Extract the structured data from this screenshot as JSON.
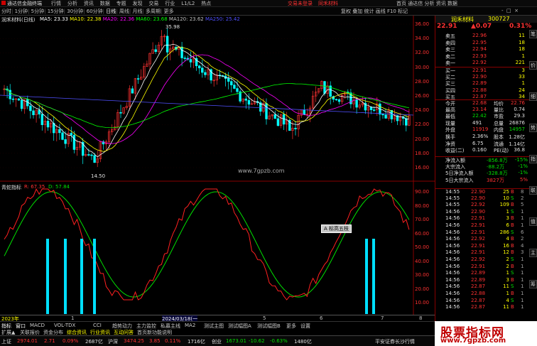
{
  "app": {
    "title": "通达信金融终端",
    "menu": [
      "行情",
      "分析",
      "资讯",
      "数据",
      "专题",
      "发现",
      "交易",
      "行业",
      "L1/L2",
      "热点"
    ],
    "ad1": "交易未登录",
    "ad2": "同禾材料",
    "right_menu": [
      "首页",
      "通达信",
      "分析",
      "资讯",
      "数据"
    ]
  },
  "toolbar": {
    "periods": [
      "分时",
      "1分钟",
      "5分钟",
      "15分钟",
      "30分钟",
      "60分钟",
      "日线",
      "周线",
      "月线",
      "多周期",
      "更多"
    ],
    "right": [
      "复权",
      "叠加",
      "统计",
      "画线",
      "F10",
      "标记",
      "-",
      "□",
      "×"
    ]
  },
  "stock": {
    "name": "润禾材料",
    "code": "300727",
    "price": "22.91",
    "change": "0.07",
    "pct": "0.31%",
    "chart_title": "润禾材料(日线)",
    "ma": [
      {
        "label": "MA5: 23.33",
        "color": "#ffffff"
      },
      {
        "label": "MA10: 22.38",
        "color": "#ffff00"
      },
      {
        "label": "MA20: 22.36",
        "color": "#ff00ff"
      },
      {
        "label": "MA60: 23.68",
        "color": "#00ff00"
      },
      {
        "label": "MA120: 23.62",
        "color": "#c0c0c0"
      },
      {
        "label": "MA250: 25.42",
        "color": "#5050ff"
      }
    ],
    "high_label": "35.98",
    "low_label": "14.50",
    "watermark": "www.7gpzb.com"
  },
  "price_axis": [
    "36.00",
    "34.00",
    "32.00",
    "30.00",
    "28.00",
    "26.00",
    "24.00",
    "22.00",
    "20.00",
    "18.00",
    "16.00"
  ],
  "indicator": {
    "name": "青蛇指标",
    "red_label": "R: 67.35",
    "green_label": "D: 57.84",
    "axis": [
      "90.00",
      "80.00",
      "70.00",
      "60.00",
      "50.00",
      "40.00",
      "30.00",
      "20.00",
      "10.00"
    ],
    "popup": "A 标高五枝"
  },
  "timeline": {
    "labels": [
      "2023年",
      "1",
      "2024/03/18(一",
      "5",
      "6",
      "7",
      "8"
    ]
  },
  "bottom_tabs": [
    "指标",
    "窗口",
    "MACD",
    "VOL-TDX",
    "CCI",
    "趋势动力",
    "主力监控",
    "私募主线",
    "MA2",
    "测试主图",
    "测试幅图A",
    "测试幅图B",
    "更多",
    "设置"
  ],
  "bottom_tabs2": [
    "扩展▲",
    "关联报价",
    "资金分布",
    "综合资讯",
    "行业资讯",
    "互动问答",
    "首页新功能说明"
  ],
  "orderbook": [
    {
      "label": "卖五",
      "price": "22.96",
      "vol": "11"
    },
    {
      "label": "卖四",
      "price": "22.95",
      "vol": "18"
    },
    {
      "label": "卖三",
      "price": "22.94",
      "vol": "18"
    },
    {
      "label": "卖二",
      "price": "22.93",
      "vol": "1"
    },
    {
      "label": "卖一",
      "price": "22.92",
      "vol": "221"
    },
    {
      "label": "买一",
      "price": "22.91",
      "vol": "3"
    },
    {
      "label": "买二",
      "price": "22.90",
      "vol": "33"
    },
    {
      "label": "买三",
      "price": "22.89",
      "vol": "1"
    },
    {
      "label": "买四",
      "price": "22.88",
      "vol": "24"
    },
    {
      "label": "买五",
      "price": "22.87",
      "vol": "34"
    }
  ],
  "stats": [
    {
      "l1": "今开",
      "v1": "22.68",
      "c1": "red",
      "l2": "均价",
      "v2": "22.76",
      "c2": "red"
    },
    {
      "l1": "最高",
      "v1": "23.14",
      "c1": "red",
      "l2": "量比",
      "v2": "0.74",
      "c2": "wht"
    },
    {
      "l1": "最低",
      "v1": "22.42",
      "c1": "grn",
      "l2": "市盈",
      "v2": "29.3",
      "c2": "wht"
    },
    {
      "l1": "现量",
      "v1": "491",
      "c1": "wht",
      "l2": "总量",
      "v2": "26876",
      "c2": "wht"
    },
    {
      "l1": "外盘",
      "v1": "11919",
      "c1": "red",
      "l2": "内盘",
      "v2": "14957",
      "c2": "grn"
    },
    {
      "l1": "换手",
      "v1": "2.36%",
      "c1": "wht",
      "l2": "股本",
      "v2": "1.28亿",
      "c2": "wht"
    },
    {
      "l1": "净资",
      "v1": "6.75",
      "c1": "wht",
      "l2": "流通",
      "v2": "1.14亿",
      "c2": "wht"
    },
    {
      "l1": "收益(二)",
      "v1": "0.160",
      "c1": "wht",
      "l2": "PE(动)",
      "v2": "36.8",
      "c2": "wht"
    }
  ],
  "flows": [
    {
      "label": "净流入额",
      "val": "-856.8万",
      "pct": "-15%"
    },
    {
      "label": "大宗流入",
      "val": "-88.2万",
      "pct": "-1%"
    },
    {
      "label": "5日净流入额",
      "val": "-328.8万",
      "pct": "-1%"
    },
    {
      "label": "5日大宗流入",
      "val": "3827万",
      "pct": "5%"
    }
  ],
  "ticks": [
    {
      "t": "14:55",
      "p": "22.90",
      "v": "25",
      "d": "B",
      "n": "8"
    },
    {
      "t": "14:55",
      "p": "22.90",
      "v": "10",
      "d": "S",
      "n": "2"
    },
    {
      "t": "14:55",
      "p": "22.92",
      "v": "109",
      "d": "B",
      "n": "5"
    },
    {
      "t": "14:56",
      "p": "22.90",
      "v": "1",
      "d": "S",
      "n": "1"
    },
    {
      "t": "14:56",
      "p": "22.91",
      "v": "3",
      "d": "B",
      "n": "1"
    },
    {
      "t": "14:56",
      "p": "22.91",
      "v": "6",
      "d": "B",
      "n": "1"
    },
    {
      "t": "14:56",
      "p": "22.91",
      "v": "286",
      "d": "S",
      "n": "6"
    },
    {
      "t": "14:56",
      "p": "22.92",
      "v": "4",
      "d": "B",
      "n": "2"
    },
    {
      "t": "14:56",
      "p": "22.91",
      "v": "16",
      "d": "B",
      "n": "4"
    },
    {
      "t": "14:56",
      "p": "22.91",
      "v": "12",
      "d": "B",
      "n": "3"
    },
    {
      "t": "14:56",
      "p": "22.92",
      "v": "2",
      "d": "S",
      "n": "1"
    },
    {
      "t": "14:56",
      "p": "22.91",
      "v": "2",
      "d": "B",
      "n": "1"
    },
    {
      "t": "14:56",
      "p": "22.89",
      "v": "1",
      "d": "S",
      "n": "1"
    },
    {
      "t": "14:56",
      "p": "22.89",
      "v": "3",
      "d": "B",
      "n": "1"
    },
    {
      "t": "14:56",
      "p": "22.87",
      "v": "11",
      "d": "S",
      "n": "1"
    },
    {
      "t": "14:56",
      "p": "22.88",
      "v": "1",
      "d": "B",
      "n": "1"
    },
    {
      "t": "14:56",
      "p": "22.87",
      "v": "4",
      "d": "S",
      "n": "1"
    },
    {
      "t": "14:56",
      "p": "22.87",
      "v": "11",
      "d": "B",
      "n": "1"
    }
  ],
  "right_tabs": [
    "笔",
    "价",
    "细",
    "势",
    "指",
    "联",
    "值",
    "主",
    "筹"
  ],
  "status": {
    "items": [
      {
        "name": "上证",
        "price": "2974.01",
        "chg": "2.71",
        "pct": "0.09%",
        "vol": "2687亿"
      },
      {
        "name": "沪深",
        "price": "3474.25",
        "chg": "3.85",
        "pct": "0.11%",
        "vol": "1716亿"
      },
      {
        "name": "创业",
        "price": "1673.01",
        "chg": "-10.62",
        "pct": "-0.63%",
        "vol": "1480亿"
      }
    ],
    "server": "平安证券长沙行情"
  },
  "banner": {
    "line1": "股票指标网",
    "line2": "www.7gpzb.com"
  },
  "colors": {
    "up": "#ff3232",
    "down": "#00ffff",
    "bg": "#000000"
  }
}
